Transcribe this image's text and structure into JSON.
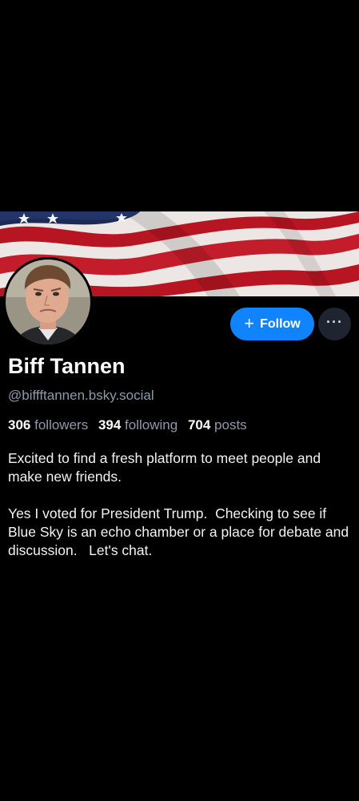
{
  "profile": {
    "display_name": "Biff Tannen",
    "handle": "@biffftannen.bsky.social",
    "stats": {
      "followers_count": "306",
      "followers_label": "followers",
      "following_count": "394",
      "following_label": "following",
      "posts_count": "704",
      "posts_label": "posts"
    },
    "bio": [
      "Excited to find a fresh platform to meet people and make new friends.",
      "Yes I voted for President Trump.  Checking to see if Blue Sky is an echo chamber or a place for debate and discussion.   Let's chat."
    ]
  },
  "actions": {
    "follow_icon": "plus-icon",
    "follow_plus": "+",
    "follow_label": "Follow",
    "more_icon": "ellipsis-icon",
    "more_label": "···"
  },
  "colors": {
    "background": "#000000",
    "accent": "#1083fe",
    "muted_text": "#8e9aab",
    "more_button_bg": "#1e2530"
  }
}
